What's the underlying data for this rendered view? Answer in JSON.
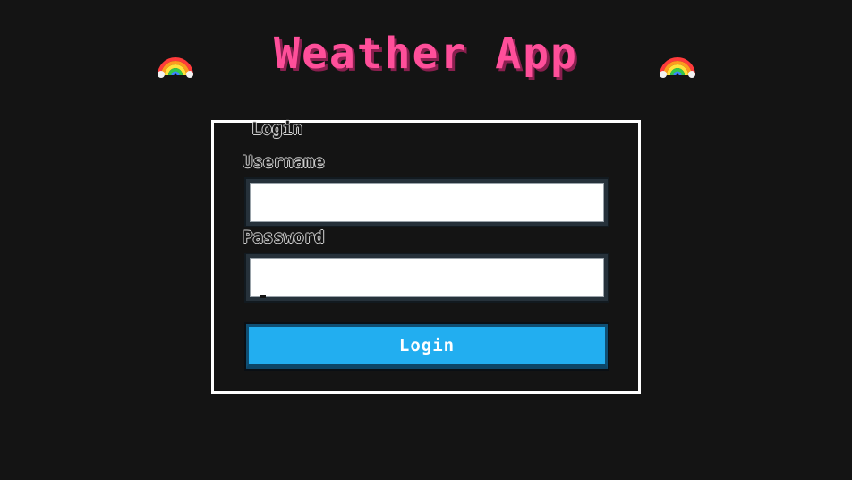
{
  "app": {
    "title": "Weather App",
    "title_color": "#ff4f9a",
    "background_color": "#141414",
    "decor_icon": "rainbow-icon"
  },
  "login": {
    "legend": "Login",
    "username_label": "Username",
    "username_value": "",
    "password_label": "Password",
    "password_value": "",
    "submit_label": "Login",
    "submit_color": "#22aef0"
  }
}
